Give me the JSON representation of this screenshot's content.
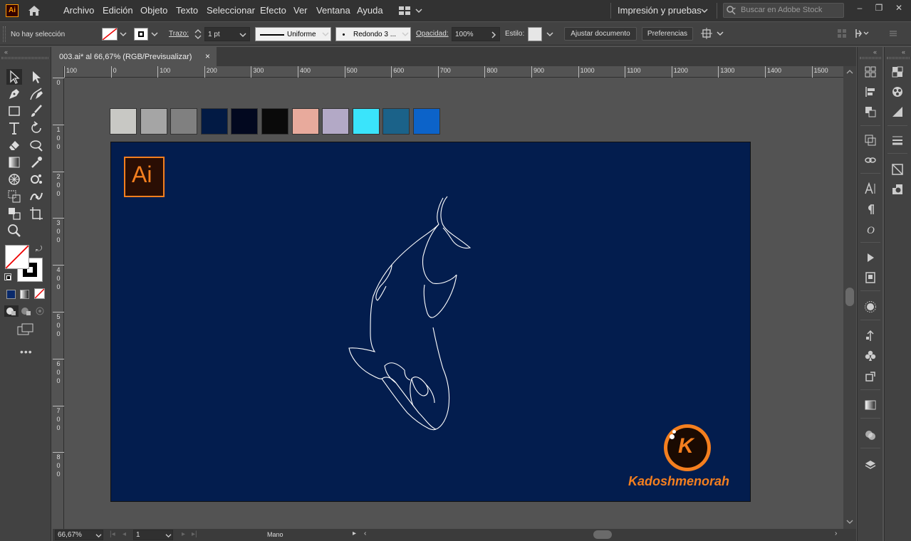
{
  "app": {
    "logo_text": "Ai",
    "menu": [
      "Archivo",
      "Edición",
      "Objeto",
      "Texto",
      "Seleccionar",
      "Efecto",
      "Ver",
      "Ventana",
      "Ayuda"
    ],
    "workspace": "Impresión y pruebas",
    "search_placeholder": "Buscar en Adobe Stock"
  },
  "control_bar": {
    "selection": "No hay selección",
    "stroke_label": "Trazo:",
    "stroke_value": "1 pt",
    "profile": "Uniforme",
    "brush": "Redondo 3 ...",
    "opacity_label": "Opacidad:",
    "opacity_value": "100%",
    "style_label": "Estilo:",
    "fit_button": "Ajustar documento",
    "prefs_button": "Preferencias"
  },
  "document": {
    "tab_title": "003.ai* al 66,67% (RGB/Previsualizar)",
    "close": "×"
  },
  "ruler_h": [
    "100",
    "0",
    "100",
    "200",
    "300",
    "400",
    "500",
    "600",
    "700",
    "800",
    "900",
    "1000",
    "1100",
    "1200",
    "1300",
    "1400",
    "1500"
  ],
  "ruler_v": [
    "0",
    "100",
    "200",
    "300",
    "400",
    "500",
    "600",
    "700",
    "800"
  ],
  "swatches": [
    "#c8c8c4",
    "#a5a5a5",
    "#808080",
    "#021a44",
    "#02081f",
    "#0a0a0a",
    "#e8aa9c",
    "#b3a9c6",
    "#3ae4fb",
    "#1b6289",
    "#0c63c9"
  ],
  "artboard": {
    "background": "#031d4e",
    "ai_badge": "Ai",
    "watermark_letter": "K",
    "watermark_text": "Kadoshmenorah",
    "accent": "#f47f1f"
  },
  "status": {
    "zoom": "66,67%",
    "page": "1",
    "tool": "Mano"
  }
}
